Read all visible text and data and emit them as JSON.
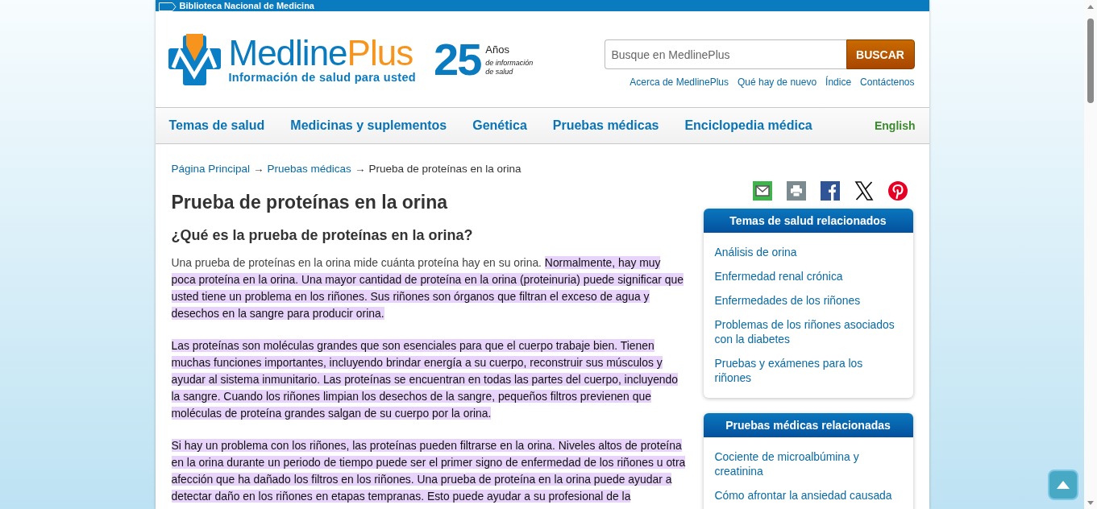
{
  "top_bar": {
    "label": "Biblioteca Nacional de Medicina"
  },
  "logo": {
    "name": [
      "Medline",
      "Plus"
    ],
    "tagline": "Información de salud para usted"
  },
  "anniversary": {
    "number": "25",
    "label": "Años",
    "caption": "de información de salud"
  },
  "search": {
    "placeholder": "Busque en MedlinePlus",
    "button": "BUSCAR"
  },
  "header_links": [
    "Acerca de MedlinePlus",
    "Qué hay de nuevo",
    "Índice",
    "Contáctenos"
  ],
  "nav": {
    "items": [
      "Temas de salud",
      "Medicinas y suplementos",
      "Genética",
      "Pruebas médicas",
      "Enciclopedia médica"
    ],
    "language": "English"
  },
  "breadcrumb": [
    {
      "kind": "link",
      "text": "Página Principal"
    },
    {
      "kind": "separator",
      "text": "→"
    },
    {
      "kind": "link",
      "text": "Pruebas médicas"
    },
    {
      "kind": "separator",
      "text": "→"
    },
    {
      "kind": "current",
      "text": "Prueba de proteínas en la orina"
    }
  ],
  "title": "Prueba de proteínas en la orina",
  "section_heading": "¿Qué es la prueba de proteínas en la orina?",
  "paragraphs": [
    {
      "segments": [
        {
          "text": "Una prueba de proteínas en la orina mide cuánta proteína hay en su orina. ",
          "highlighted": false
        },
        {
          "text": "Normalmente, hay muy poca proteína en la orina. Una mayor cantidad de proteína en la orina (proteinuria) puede significar que usted tiene un problema en los riñones. Sus riñones son órganos que filtran el exceso de agua y desechos en la sangre para producir orina.",
          "highlighted": true
        }
      ]
    },
    {
      "segments": [
        {
          "text": "Las proteínas son moléculas grandes que son esenciales para que el cuerpo trabaje bien. Tienen muchas funciones importantes, incluyendo brindar energía a su cuerpo, reconstruir sus músculos y ayudar al sistema inmunitario. Las proteínas se encuentran en todas las partes del cuerpo, incluyendo la sangre. Cuando los riñones limpian los desechos de la sangre, pequeños filtros previenen que moléculas de proteína grandes salgan de su cuerpo por la orina.",
          "highlighted": true
        }
      ]
    },
    {
      "segments": [
        {
          "text": "Si hay un problema con los riñones, las proteínas pueden filtrarse en la orina. Niveles altos de proteína en la orina durante un periodo de tiempo puede ser el primer signo de enfermedad de los riñones u otra afección que ha dañado los filtros en los riñones. Una prueba de proteína en la orina puede ayudar a detectar daño en los riñones en etapas tempranas. Esto puede ayudar a su profesional de la",
          "highlighted": true
        }
      ]
    }
  ],
  "sidebar": [
    {
      "title": "Temas de salud relacionados",
      "items": [
        "Análisis de orina",
        "Enfermedad renal crónica",
        "Enfermedades de los riñones",
        "Problemas de los riñones asociados con la diabetes",
        "Pruebas y exámenes para los riñones"
      ]
    },
    {
      "title": "Pruebas médicas relacionadas",
      "items": [
        "Cociente de microalbúmina y creatinina",
        "Cómo afrontar la ansiedad causada"
      ]
    }
  ]
}
